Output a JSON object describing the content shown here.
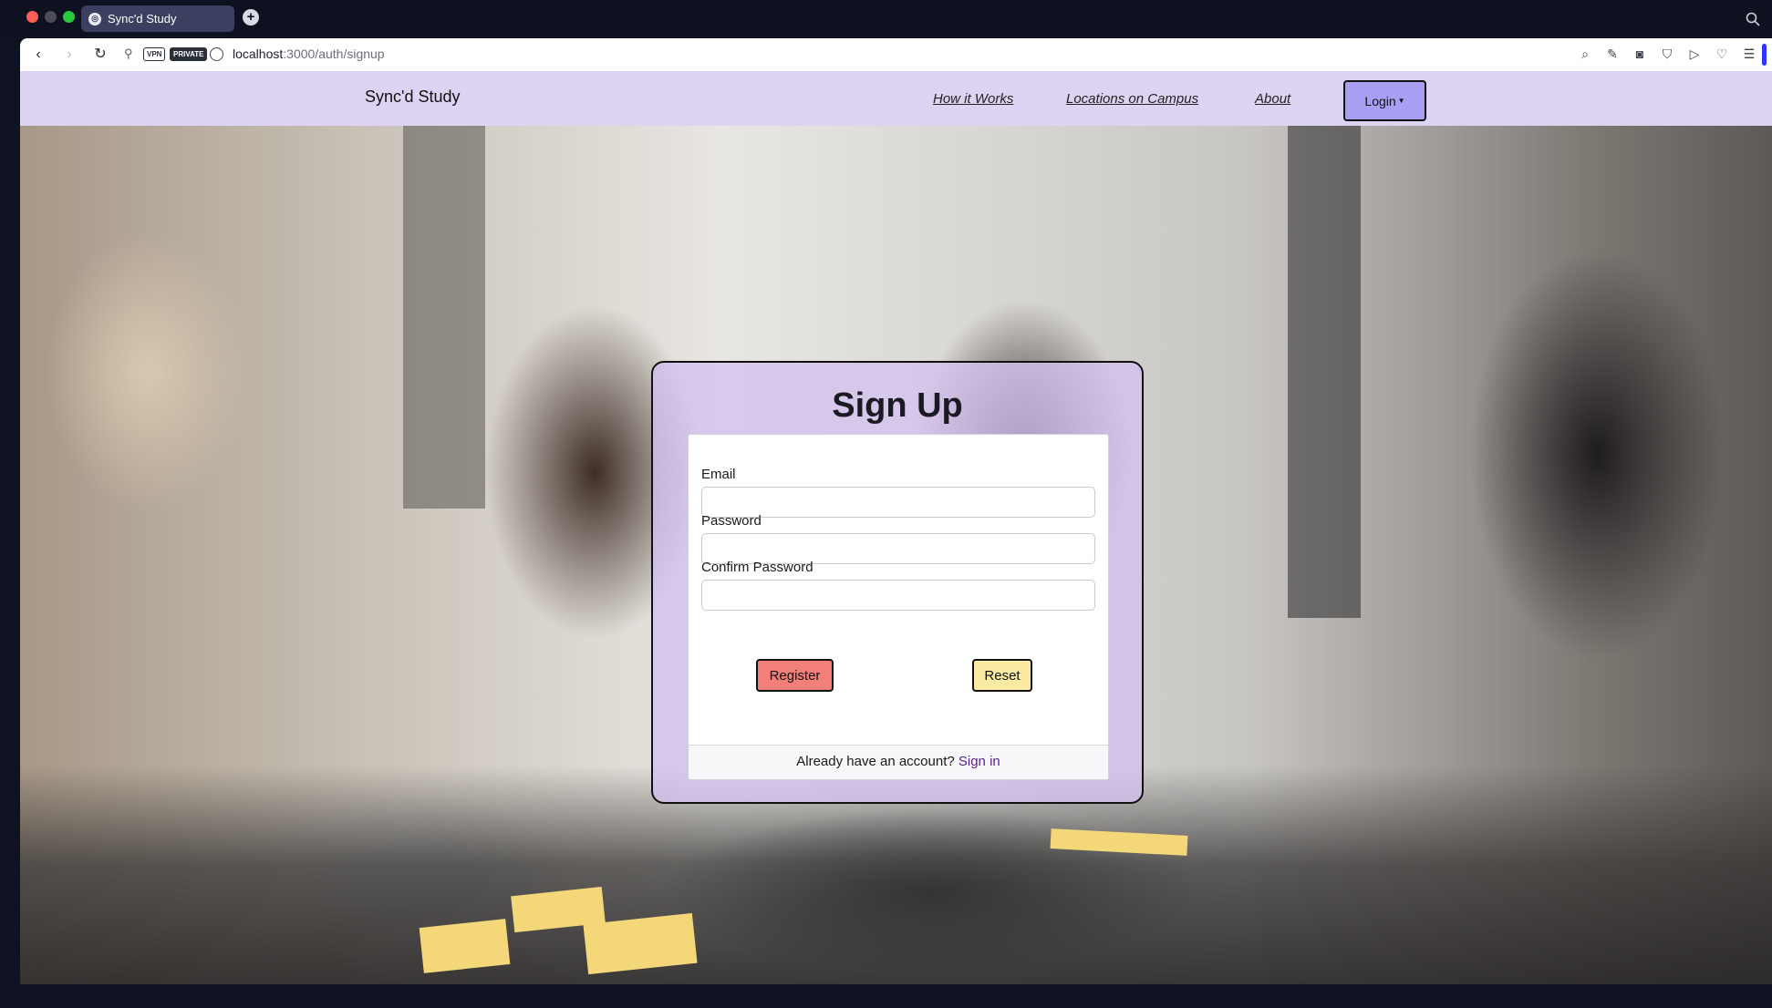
{
  "browser": {
    "tab_title": "Sync'd Study",
    "url_host": "localhost",
    "url_path": ":3000/auth/signup",
    "badges": {
      "vpn": "VPN",
      "private": "PRIVATE"
    },
    "icons": {
      "back": "chevron-left-icon",
      "forward": "chevron-right-icon",
      "reload": "reload-icon",
      "key": "key-icon",
      "globe": "globe-icon",
      "toolbar": [
        "search-icon",
        "edit-icon",
        "camera-icon",
        "shield-icon",
        "send-icon",
        "heart-icon",
        "menu-icon"
      ]
    }
  },
  "navbar": {
    "brand": "Sync'd Study",
    "links": [
      "How it Works",
      "Locations on Campus",
      "About"
    ],
    "login_label": "Login"
  },
  "signup": {
    "title": "Sign Up",
    "email_label": "Email",
    "email_value": "",
    "password_label": "Password",
    "password_value": "",
    "confirm_label": "Confirm Password",
    "confirm_value": "",
    "register_label": "Register",
    "reset_label": "Reset",
    "footer_text": "Already have an account?",
    "signin_label": "Sign in"
  },
  "colors": {
    "navbar_bg": "#ddd4f4",
    "login_bg": "#a89ef2",
    "card_bg": "#d3c2f0",
    "register_bg": "#f37f7a",
    "reset_bg": "#fbeaa2",
    "signin_link": "#5b1f86"
  }
}
